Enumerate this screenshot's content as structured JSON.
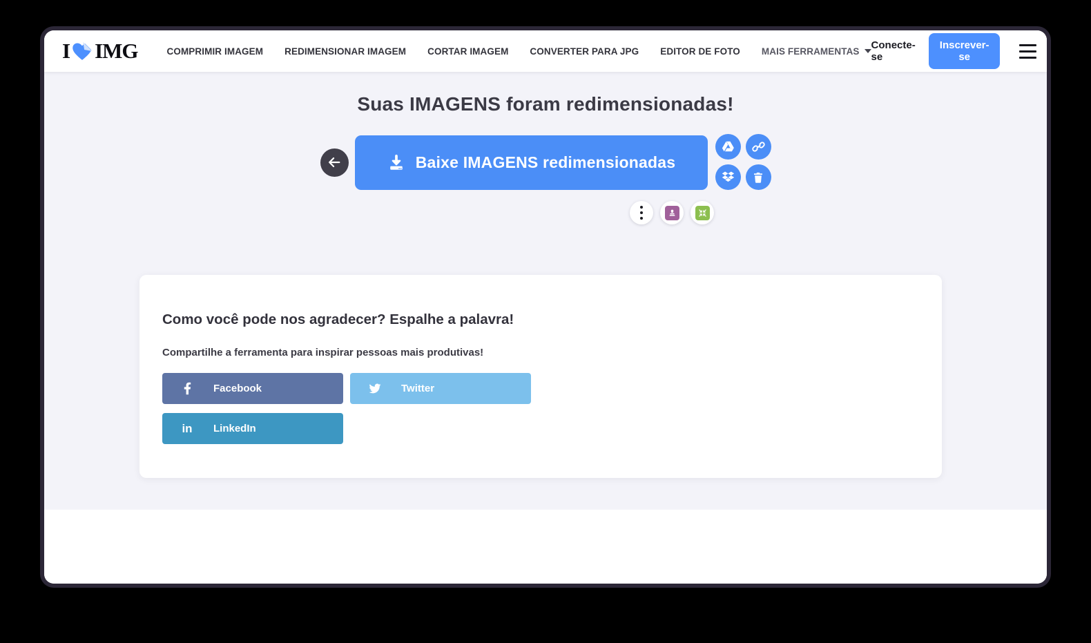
{
  "nav": {
    "logo": {
      "part1": "I",
      "part2": "IMG",
      "heart_icon": "heart-folded-corner-icon"
    },
    "items": [
      "COMPRIMIR IMAGEM",
      "REDIMENSIONAR IMAGEM",
      "CORTAR IMAGEM",
      "CONVERTER PARA JPG",
      "EDITOR DE FOTO"
    ],
    "more_label": "MAIS FERRAMENTAS",
    "login_label": "Conecte-se",
    "signup_label": "Inscrever-se",
    "menu_icon": "hamburger-icon"
  },
  "main": {
    "heading": "Suas IMAGENS foram redimensionadas!",
    "back_icon": "arrow-left-icon",
    "download_button_label": "Baixe IMAGENS redimensionadas",
    "download_icon": "download-icon",
    "cloud_actions": [
      "google-drive-icon",
      "link-icon",
      "dropbox-icon",
      "trash-icon"
    ],
    "mini_actions": [
      "more-options-icon",
      "watermark-stamp-icon",
      "compress-arrows-icon"
    ]
  },
  "share_card": {
    "title": "Como você pode nos agradecer? Espalhe a palavra!",
    "subtitle": "Compartilhe a ferramenta para inspirar pessoas mais produtivas!",
    "buttons": [
      {
        "label": "Facebook",
        "color": "#5e74a5",
        "icon": "facebook-icon"
      },
      {
        "label": "Twitter",
        "color": "#7cc0ec",
        "icon": "twitter-icon"
      },
      {
        "label": "LinkedIn",
        "color": "#3d97c2",
        "icon": "linkedin-icon"
      }
    ]
  },
  "colors": {
    "accent_blue": "#4d90fe",
    "button_blue": "#4b8ef7",
    "page_background": "#f3f3f9",
    "window_ring": "#2c2737",
    "back_button": "#413f4a",
    "watermark_purple": "#a0609a",
    "compress_green": "#8cbf4f"
  }
}
